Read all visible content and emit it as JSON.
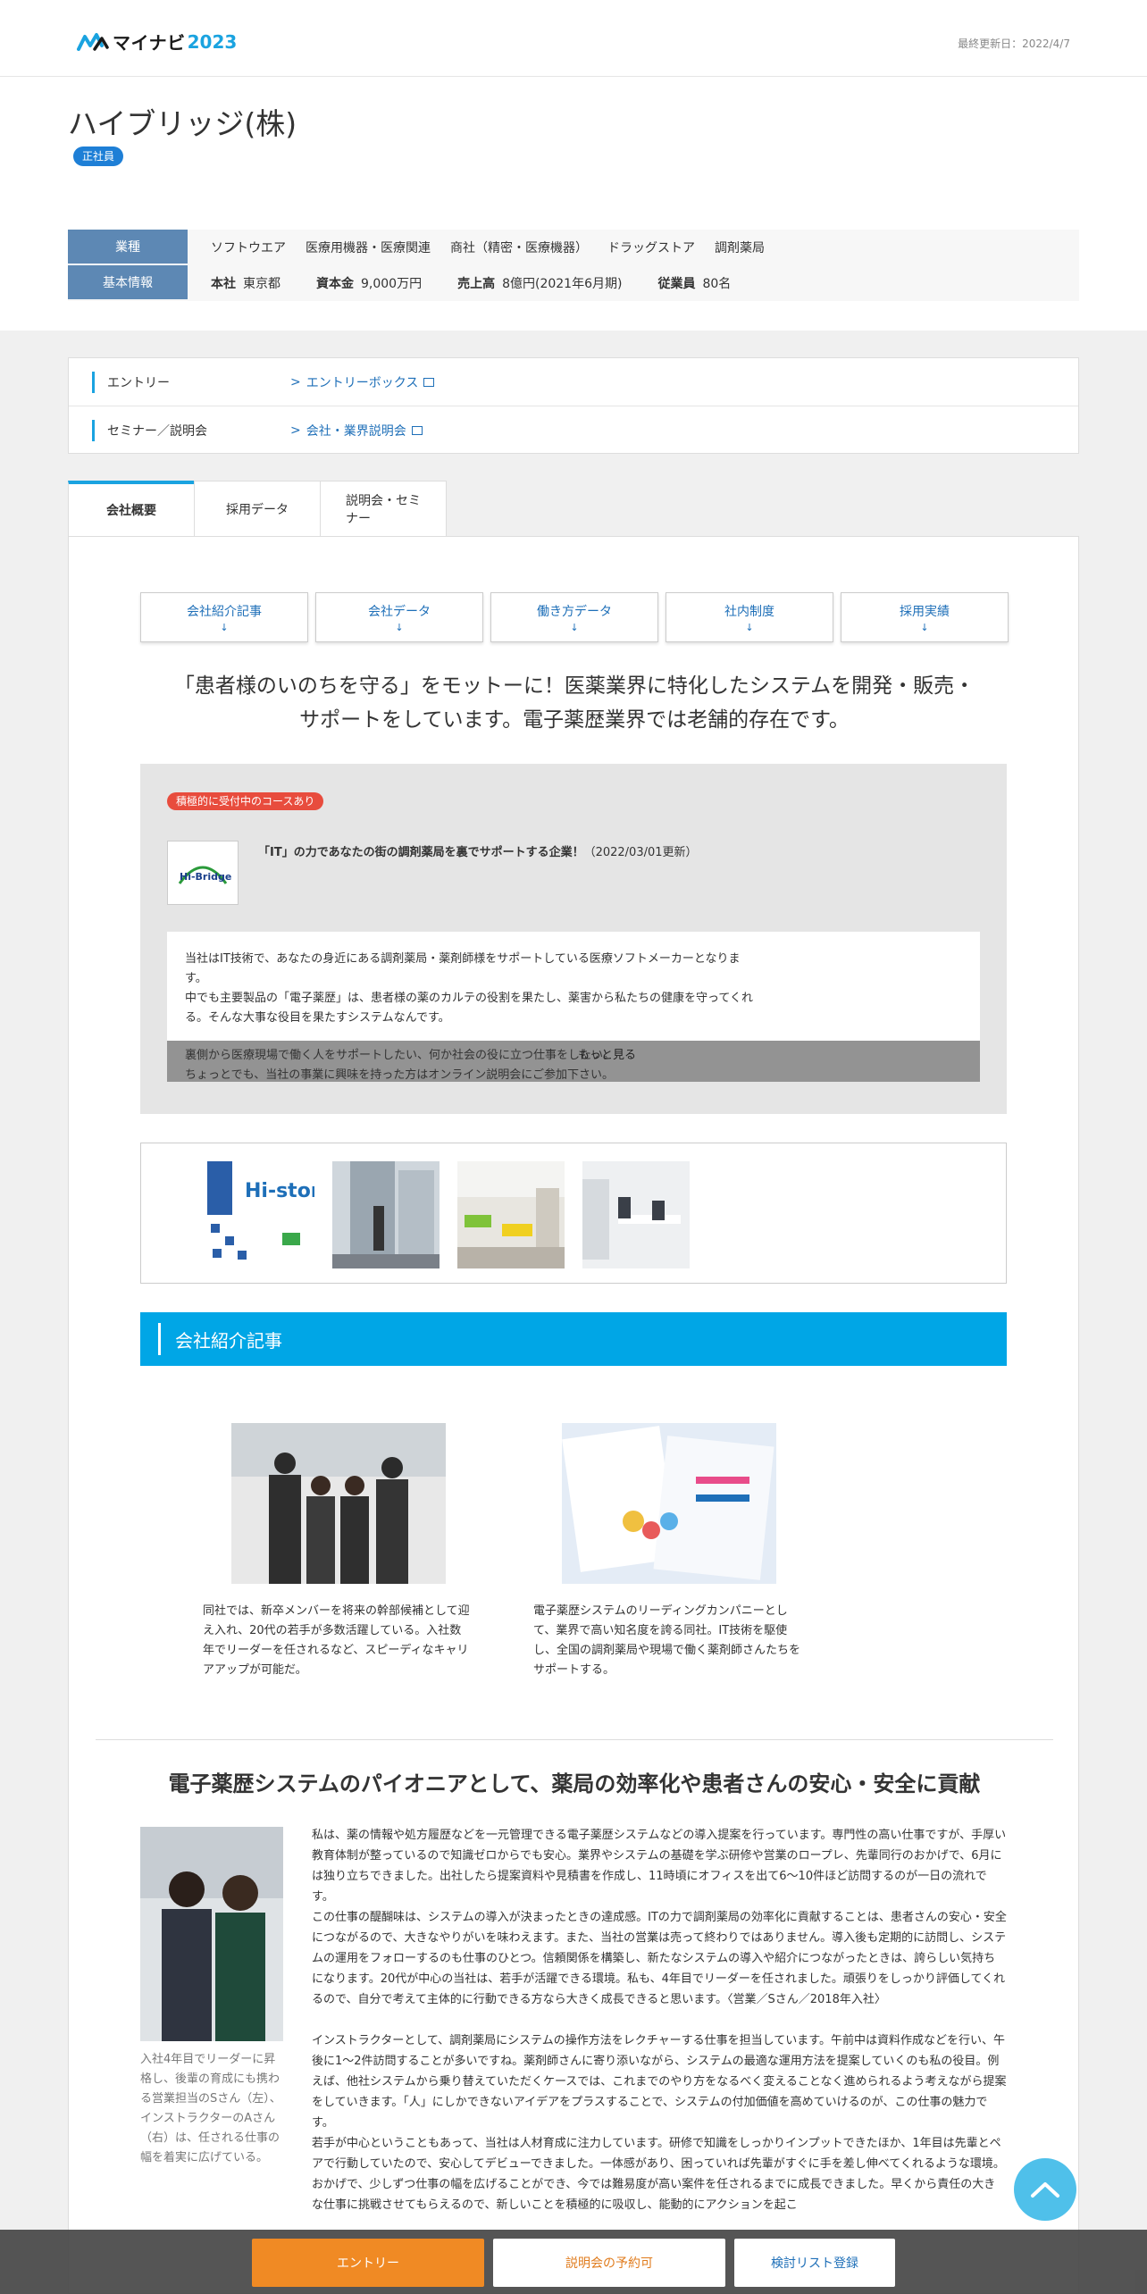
{
  "header": {
    "logo_text": "マイナビ",
    "logo_year": "2023",
    "updated": "最終更新日：2022/4/7"
  },
  "company": {
    "name": "ハイブリッジ(株)",
    "badge": "正社員",
    "industry_label": "業種",
    "industries": [
      "ソフトウエア",
      "医療用機器・医療関連",
      "商社（精密・医療機器）",
      "ドラッグストア",
      "調剤薬局"
    ],
    "basic_label": "基本情報",
    "hq_label": "本社",
    "hq_value": "東京都",
    "capital_label": "資本金",
    "capital_value": "9,000万円",
    "sales_label": "売上高",
    "sales_value": "8億円(2021年6月期)",
    "employees_label": "従業員",
    "employees_value": "80名"
  },
  "entry": {
    "row1_label": "エントリー",
    "row1_link": "エントリーボックス",
    "row2_label": "セミナー／説明会",
    "row2_link": "会社・業界説明会"
  },
  "tabs": [
    "会社概要",
    "採用データ",
    "説明会・セミナー"
  ],
  "subnav": [
    {
      "label": "会社紹介記事",
      "arrow": "↓"
    },
    {
      "label": "会社データ",
      "arrow": "↓"
    },
    {
      "label": "働き方データ",
      "arrow": "↓"
    },
    {
      "label": "社内制度",
      "arrow": "↓"
    },
    {
      "label": "採用実績",
      "arrow": "↓"
    }
  ],
  "catch": {
    "line1": "「患者様のいのちを守る」をモットーに！医薬業界に特化したシステムを開発・販売・",
    "line2": "サポートをしています。電子薬歴業界では老舗的存在です。"
  },
  "pickup": {
    "badge": "積極的に受付中のコースあり",
    "logo_text": "Hi-Bridge",
    "title": "「IT」の力であなたの街の調剤薬局を裏でサポートする企業！",
    "date": "（2022/03/01更新）",
    "body1": "当社はIT技術で、あなたの身近にある調剤薬局・薬剤師様をサポートしている医療ソフトメーカーとなります。",
    "body2": "中でも主要製品の「電子薬歴」は、患者様の薬のカルテの役割を果たし、薬害から私たちの健康を守ってくれる。そんな大事な役目を果たすシステムなんです。",
    "body3": "裏側から医療現場で働く人をサポートしたい、何か社会の役に立つ仕事をしたい。",
    "body4": "ちょっとでも、当社の事業に興味を持った方はオンライン説明会にご参加下さい。",
    "more": "もっと見る"
  },
  "section_title": "会社紹介記事",
  "articles": [
    {
      "text": "同社では、新卒メンバーを将来の幹部候補として迎え入れ、20代の若手が多数活躍している。入社数年でリーダーを任されるなど、スピーディなキャリアアップが可能だ。"
    },
    {
      "text": "電子薬歴システムのリーディングカンパニーとして、業界で高い知名度を誇る同社。IT技術を駆使し、全国の調剤薬局や現場で働く薬剤師さんたちをサポートする。"
    }
  ],
  "story": {
    "heading": "電子薬歴システムのパイオニアとして、薬局の効率化や患者さんの安心・安全に貢献",
    "caption": "入社4年目でリーダーに昇格し、後輩の育成にも携わる営業担当のSさん（左）、インストラクターのAさん（右）は、任される仕事の幅を着実に広げている。",
    "p1": "私は、薬の情報や処方履歴などを一元管理できる電子薬歴システムなどの導入提案を行っています。専門性の高い仕事ですが、手厚い教育体制が整っているので知識ゼロからでも安心。業界やシステムの基礎を学ぶ研修や営業のロープレ、先輩同行のおかげで、6月には独り立ちできました。出社したら提案資料や見積書を作成し、11時頃にオフィスを出て6～10件ほど訪問するのが一日の流れです。",
    "p1b": "この仕事の醍醐味は、システムの導入が決まったときの達成感。ITの力で調剤薬局の効率化に貢献することは、患者さんの安心・安全につながるので、大きなやりがいを味わえます。また、当社の営業は売って終わりではありません。導入後も定期的に訪問し、システムの運用をフォローするのも仕事のひとつ。信頼関係を構築し、新たなシステムの導入や紹介につながったときは、誇らしい気持ちになります。20代が中心の当社は、若手が活躍できる環境。私も、4年目でリーダーを任されました。頑張りをしっかり評価してくれるので、自分で考えて主体的に行動できる方なら大きく成長できると思います。〈営業／Sさん／2018年入社〉",
    "p2": "インストラクターとして、調剤薬局にシステムの操作方法をレクチャーする仕事を担当しています。午前中は資料作成などを行い、午後に1～2件訪問することが多いですね。薬剤師さんに寄り添いながら、システムの最適な運用方法を提案していくのも私の役目。例えば、他社システムから乗り替えていただくケースでは、これまでのやり方をなるべく変えることなく進められるよう考えながら提案をしていきます。「人」にしかできないアイデアをプラスすることで、システムの付加価値を高めていけるのが、この仕事の魅力です。",
    "p2b": "若手が中心ということもあって、当社は人材育成に注力しています。研修で知識をしっかりインプットできたほか、1年目は先輩とペアで行動していたので、安心してデビューできました。一体感があり、困っていれば先輩がすぐに手を差し伸べてくれるような環境。おかげで、少しずつ仕事の幅を広げることができ、今では難易度が高い案件を任されるまでに成長できました。早くから責任の大きな仕事に挑戦させてもらえるので、新しいことを積極的に吸収し、能動的にアクションを起こ"
  },
  "bottom_bar": {
    "entry": "エントリー",
    "seminar": "説明会の予約可",
    "list": "検討リスト登録"
  },
  "colors": {
    "accent": "#00a6e6",
    "badge_blue": "#1e7fd6",
    "tag_red": "#e84c3d",
    "entry_orange": "#f08a24",
    "info_key": "#5d88b4"
  }
}
